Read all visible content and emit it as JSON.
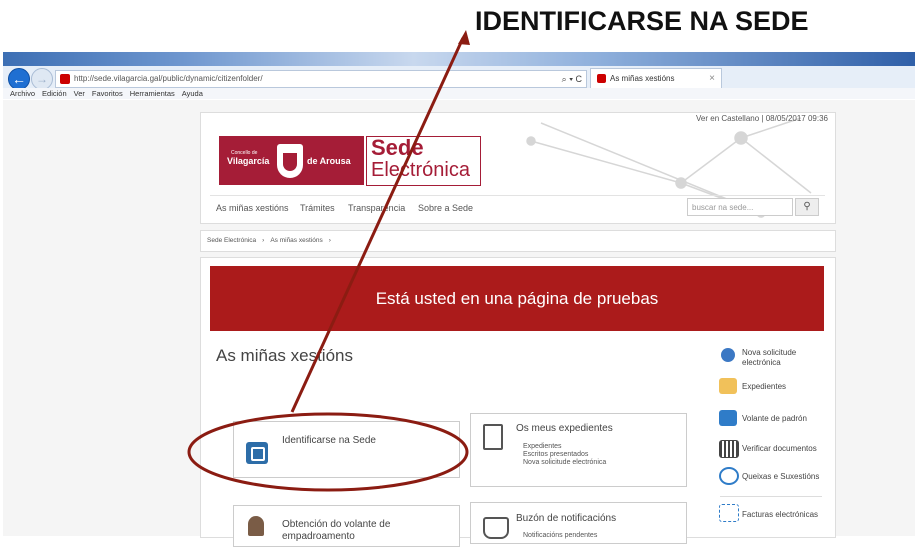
{
  "annotation": {
    "title": "IDENTIFICARSE NA SEDE"
  },
  "browser": {
    "url": "http://sede.vilagarcia.gal/public/dynamic/citizenfolder/",
    "tab_title": "As miñas xestións",
    "addr_tools": "⌕ ▾ C",
    "menu": [
      "Archivo",
      "Edición",
      "Ver",
      "Favoritos",
      "Herramientas",
      "Ayuda"
    ]
  },
  "header": {
    "top_links": "Ver en Castellano | 08/05/2017 09:36",
    "logo": {
      "concello": "Concello de",
      "vilagarcia": "Vilagarcía",
      "arousa": "de Arousa"
    },
    "sede_line1": "Sede",
    "sede_line2": "Electrónica",
    "nav": [
      "As miñas xestións",
      "Trámites",
      "Transparencia",
      "Sobre a Sede"
    ],
    "search_placeholder": "buscar na sede..."
  },
  "breadcrumb": [
    "Sede Electrónica",
    "As miñas xestións"
  ],
  "banner": "Está usted en una página de pruebas",
  "page_title": "As miñas xestións",
  "cards": {
    "identificarse": "Identificarse na Sede",
    "expedientes_title": "Os meus expedientes",
    "expedientes_items": [
      "Expedientes",
      "Escritos presentados",
      "Nova solicitude electrónica"
    ],
    "volante": "Obtención do volante de empadroamento",
    "buzon_title": "Buzón de notificacións",
    "buzon_items": [
      "Notificacións pendentes"
    ]
  },
  "sidebar": [
    {
      "label": "Nova solicitude electrónica",
      "icon": "person-icon"
    },
    {
      "label": "Expedientes",
      "icon": "folder-icon"
    },
    {
      "label": "Volante de padrón",
      "icon": "document-icon"
    },
    {
      "label": "Verificar documentos",
      "icon": "barcode-icon"
    },
    {
      "label": "Queixas e Suxestións",
      "icon": "speech-bubble-icon"
    },
    {
      "label": "Facturas electrónicas",
      "icon": "invoice-icon"
    }
  ],
  "colors": {
    "brand_red": "#a51d37",
    "banner_red": "#ab1b1b",
    "annotation_arrow": "#8b1c12"
  }
}
